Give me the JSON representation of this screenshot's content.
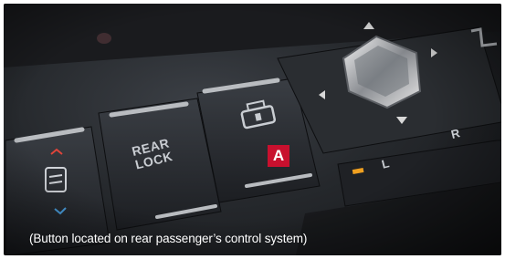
{
  "photo": {
    "caption": "(Button located on rear passenger’s control system)",
    "badge_label": "A",
    "rear_lock_line1": "REAR",
    "rear_lock_line2": "LOCK",
    "l_label": "L",
    "r_label": "R",
    "icons": [
      "seat-heat-icon",
      "window-lock-icon",
      "joystick-icon",
      "seat-adjust-icon",
      "ventilation-icon"
    ],
    "colors": {
      "badge": "#c8102e",
      "indicator_amber": "#f0a020",
      "caption_text": "#ffffff"
    }
  }
}
